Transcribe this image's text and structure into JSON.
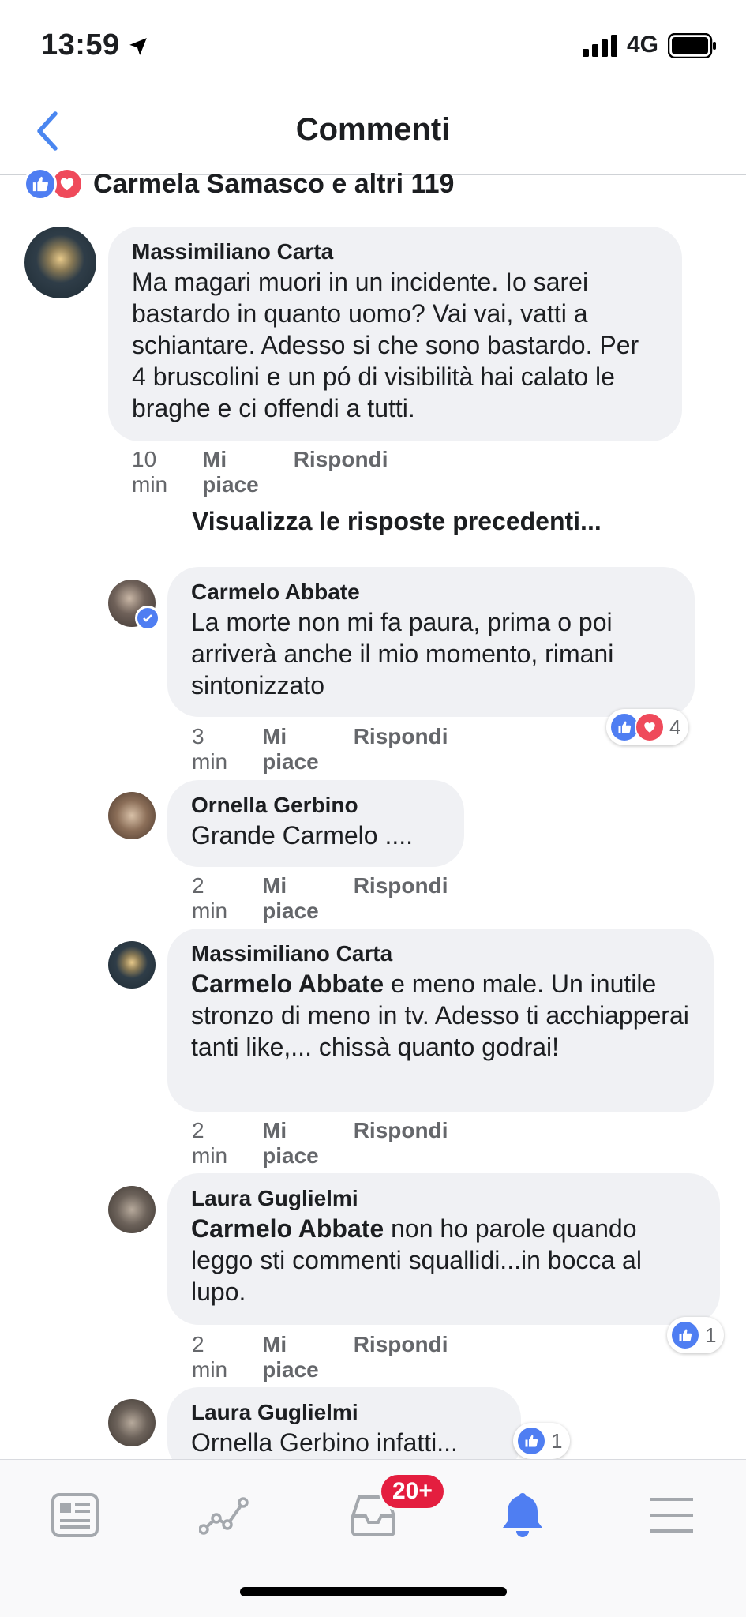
{
  "status": {
    "time": "13:59",
    "network": "4G"
  },
  "nav": {
    "title": "Commenti"
  },
  "summary": {
    "text": "Carmela Samasco e altri 119"
  },
  "more_replies": "Visualizza le risposte precedenti...",
  "comments": [
    {
      "author": "Massimiliano Carta",
      "text": "Ma magari muori in un incidente. Io sarei bastardo in quanto uomo? Vai vai, vatti a schiantare. Adesso si che sono bastardo. Per 4 bruscolini e un pó di visibilità hai calato le braghe e ci offendi a tutti.",
      "time": "10 min",
      "like": "Mi piace",
      "reply": "Rispondi"
    },
    {
      "author": "Carmelo Abbate",
      "text": "La morte non mi fa paura, prima o poi arriverà anche il mio momento, rimani sintonizzato",
      "time": "3 min",
      "like": "Mi piace",
      "reply": "Rispondi",
      "reaction_count": "4"
    },
    {
      "author": "Ornella Gerbino",
      "text": "Grande Carmelo ....",
      "time": "2 min",
      "like": "Mi piace",
      "reply": "Rispondi"
    },
    {
      "author": "Massimiliano Carta",
      "mention": "Carmelo Abbate",
      "text": " e meno male. Un inutile stronzo di meno in tv. Adesso ti acchiapperai tanti like,... chissà quanto godrai!",
      "time": "2 min",
      "like": "Mi piace",
      "reply": "Rispondi"
    },
    {
      "author": "Laura Guglielmi",
      "mention": "Carmelo Abbate",
      "text": " non ho parole quando leggo sti commenti squallidi...in bocca al lupo.",
      "time": "2 min",
      "like": "Mi piace",
      "reply": "Rispondi",
      "reaction_count": "1"
    },
    {
      "author": "Laura Guglielmi",
      "text": "Ornella Gerbino infatti...",
      "reaction_count": "1"
    }
  ],
  "tabbar": {
    "badge": "20+"
  },
  "colors": {
    "like": "#4f7ef2",
    "love": "#ef4a5b",
    "accent": "#4a86f0",
    "badge": "#e41e3f"
  }
}
